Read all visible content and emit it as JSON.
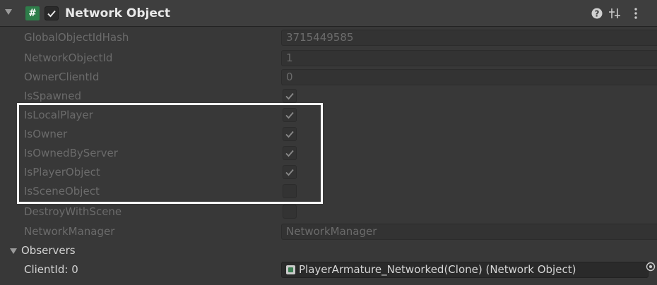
{
  "header": {
    "script_icon_glyph": "#",
    "enabled": true,
    "title": "Network Object",
    "icons": [
      "help-icon",
      "preset-icon",
      "context-menu-icon"
    ]
  },
  "fields": {
    "global_object_id_hash": {
      "label": "GlobalObjectIdHash",
      "value": "3715449585"
    },
    "network_object_id": {
      "label": "NetworkObjectId",
      "value": "1"
    },
    "owner_client_id": {
      "label": "OwnerClientId",
      "value": "0"
    },
    "is_spawned": {
      "label": "IsSpawned",
      "checked": true
    },
    "is_local_player": {
      "label": "IsLocalPlayer",
      "checked": true
    },
    "is_owner": {
      "label": "IsOwner",
      "checked": true
    },
    "is_owned_by_server": {
      "label": "IsOwnedByServer",
      "checked": true
    },
    "is_player_object": {
      "label": "IsPlayerObject",
      "checked": true
    },
    "is_scene_object": {
      "label": "IsSceneObject",
      "checked": false
    },
    "destroy_with_scene": {
      "label": "DestroyWithScene",
      "checked": false
    },
    "network_manager": {
      "label": "NetworkManager",
      "value": "NetworkManager"
    }
  },
  "observers": {
    "label": "Observers",
    "expanded": true,
    "items": [
      {
        "label": "ClientId: 0",
        "value": "PlayerArmature_Networked(Clone) (Network Object)"
      }
    ]
  },
  "colors": {
    "panel_bg": "#383838",
    "highlight_border": "#ffffff",
    "script_icon_bg": "#2e7d4a"
  }
}
